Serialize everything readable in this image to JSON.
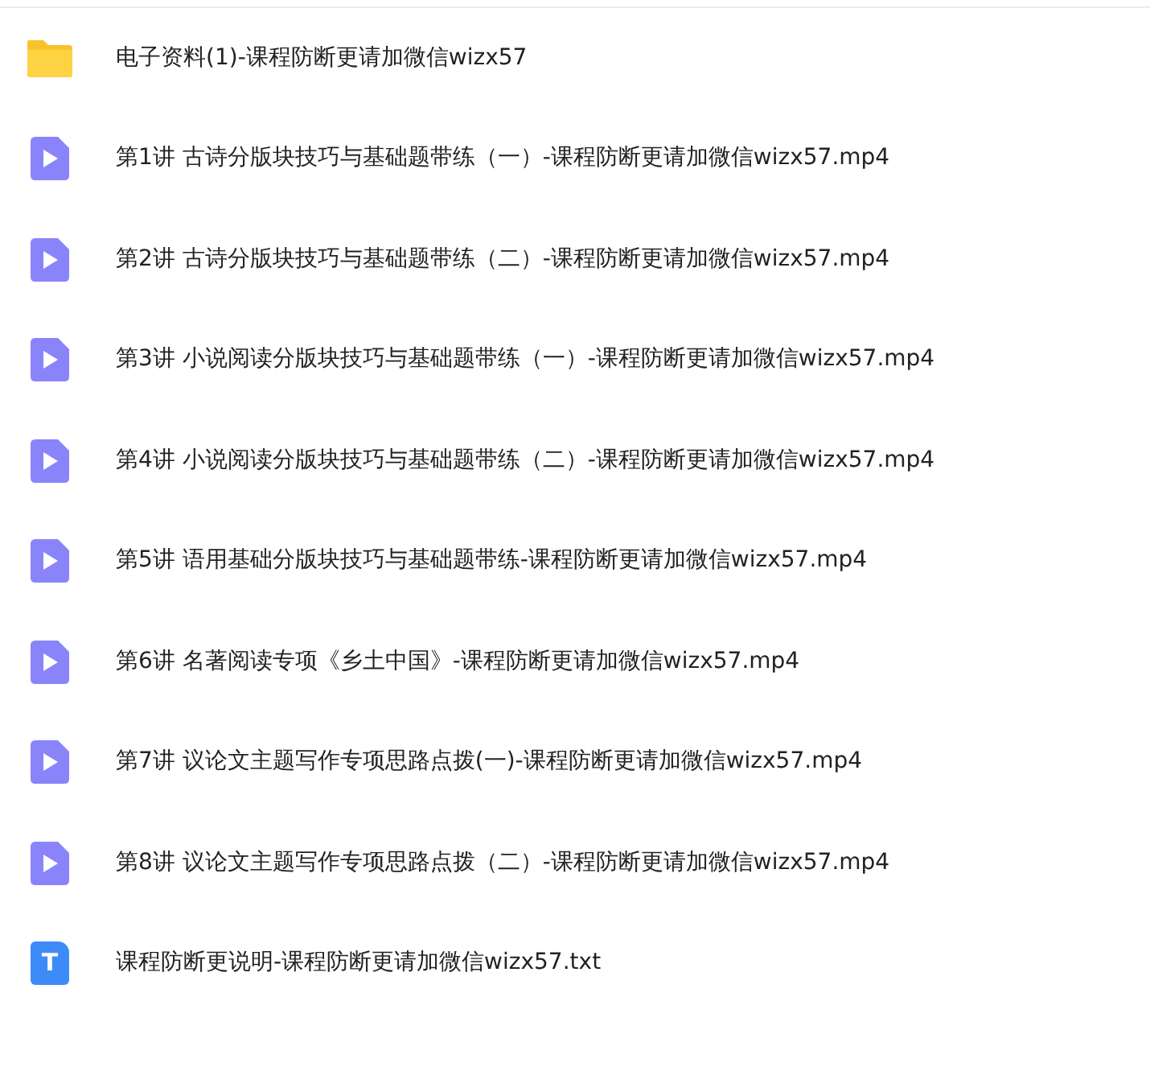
{
  "files": [
    {
      "kind": "folder",
      "name": "电子资料(1)-课程防断更请加微信wizx57"
    },
    {
      "kind": "video",
      "name": "第1讲 古诗分版块技巧与基础题带练（一）-课程防断更请加微信wizx57.mp4"
    },
    {
      "kind": "video",
      "name": "第2讲 古诗分版块技巧与基础题带练（二）-课程防断更请加微信wizx57.mp4"
    },
    {
      "kind": "video",
      "name": "第3讲 小说阅读分版块技巧与基础题带练（一）-课程防断更请加微信wizx57.mp4"
    },
    {
      "kind": "video",
      "name": "第4讲 小说阅读分版块技巧与基础题带练（二）-课程防断更请加微信wizx57.mp4"
    },
    {
      "kind": "video",
      "name": "第5讲 语用基础分版块技巧与基础题带练-课程防断更请加微信wizx57.mp4"
    },
    {
      "kind": "video",
      "name": "第6讲 名著阅读专项《乡土中国》-课程防断更请加微信wizx57.mp4"
    },
    {
      "kind": "video",
      "name": "第7讲 议论文主题写作专项思路点拨(一)-课程防断更请加微信wizx57.mp4"
    },
    {
      "kind": "video",
      "name": "第8讲 议论文主题写作专项思路点拨（二）-课程防断更请加微信wizx57.mp4"
    },
    {
      "kind": "text",
      "name": "课程防断更说明-课程防断更请加微信wizx57.txt",
      "icon_letter": "T"
    }
  ]
}
